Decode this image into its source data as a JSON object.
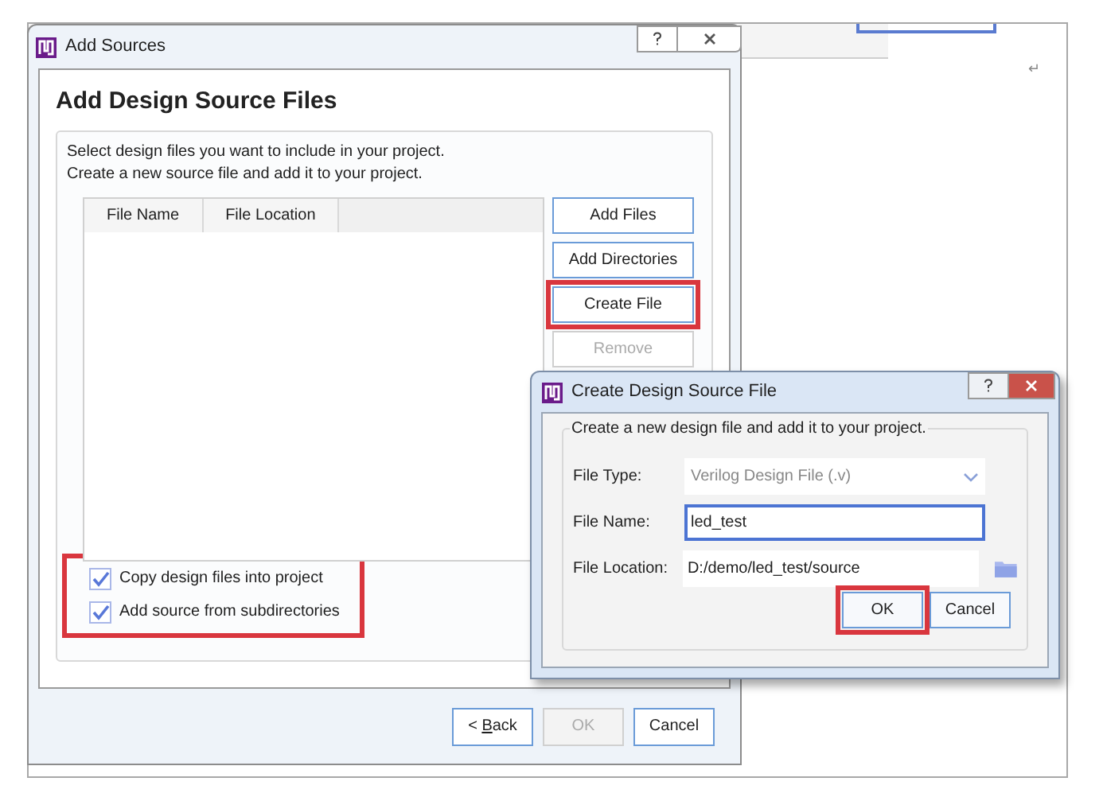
{
  "background_document": {
    "paragraph_mark": "↵"
  },
  "main_dialog": {
    "title": "Add Sources",
    "heading": "Add Design Source Files",
    "description": [
      "Select design files you want to include in your project.",
      "Create a new source file and add it to your project."
    ],
    "table": {
      "columns": [
        "File Name",
        "File Location"
      ]
    },
    "side_buttons": [
      {
        "label": "Add Files",
        "highlighted": false,
        "disabled": false
      },
      {
        "label": "Add Directories",
        "highlighted": false,
        "disabled": false
      },
      {
        "label": "Create File",
        "highlighted": true,
        "disabled": false
      },
      {
        "label": "Remove",
        "highlighted": false,
        "disabled": true
      }
    ],
    "options_highlighted": true,
    "options": [
      {
        "label": "Copy design files into project",
        "checked": true
      },
      {
        "label": "Add source from subdirectories",
        "checked": true
      }
    ],
    "footer_buttons": [
      {
        "label": "< **B**ack",
        "disabled": false
      },
      {
        "label": "OK",
        "disabled": true
      },
      {
        "label": "Cancel",
        "disabled": false
      }
    ]
  },
  "create_dialog": {
    "title": "Create Design Source File",
    "group_title": "Create a new design file and add it to your project.",
    "fields": [
      {
        "kind": "dropdown",
        "label": "File Type:",
        "value": "Verilog Design File (.v)",
        "focused": false
      },
      {
        "kind": "text",
        "label": "File Name:",
        "value": "led_test",
        "focused": true
      },
      {
        "kind": "folder",
        "label": "File Location:",
        "value": "D:/demo/led_test/source",
        "focused": false
      }
    ],
    "buttons": [
      {
        "label": "OK",
        "highlighted": true
      },
      {
        "label": "Cancel",
        "highlighted": false
      }
    ]
  }
}
